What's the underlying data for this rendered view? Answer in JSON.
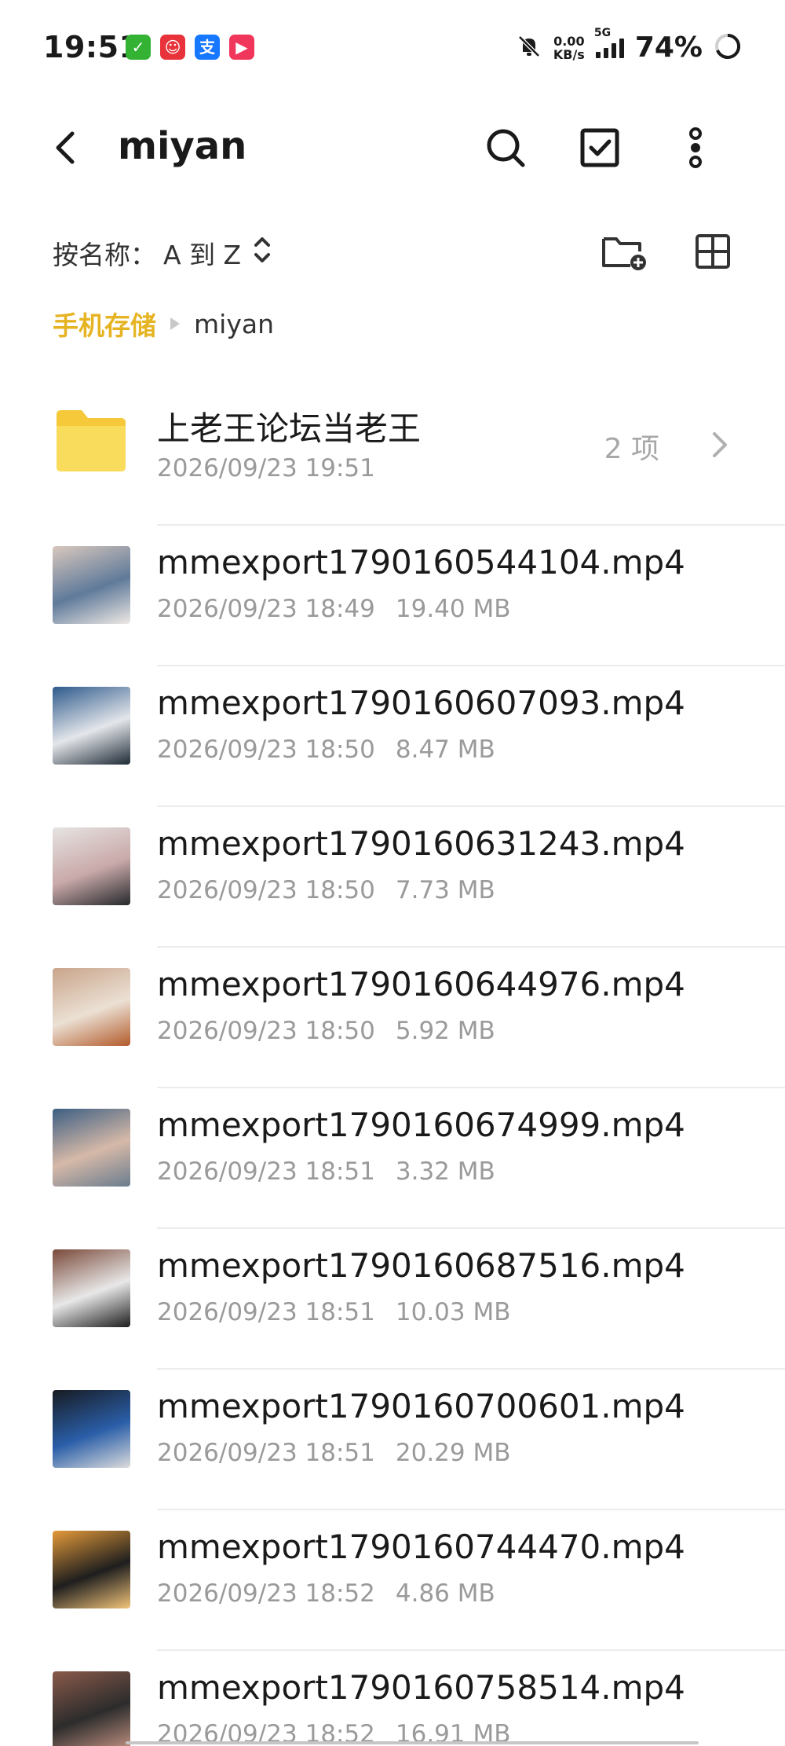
{
  "status_bar": {
    "time": "19:51",
    "app_icons": [
      {
        "name": "wechat-check-icon",
        "color": "#33b233",
        "glyph": "✓"
      },
      {
        "name": "fun-app-icon",
        "color": "#e8333a",
        "glyph": "☺"
      },
      {
        "name": "alipay-icon",
        "color": "#1677ff",
        "glyph": "支"
      },
      {
        "name": "video-app-icon",
        "color": "#f0365a",
        "glyph": "▶"
      }
    ],
    "net_speed_value": "0.00",
    "net_speed_unit": "KB/s",
    "network_type": "5G",
    "battery": "74%"
  },
  "header": {
    "title": "miyan"
  },
  "sort": {
    "label": "按名称：",
    "value": "A 到 Z"
  },
  "breadcrumb": {
    "root": "手机存储",
    "current": "miyan"
  },
  "folder": {
    "name": "上老王论坛当老王",
    "date": "2026/09/23 19:51",
    "count": "2 项"
  },
  "files": [
    {
      "name": "mmexport1790160544104.mp4",
      "date": "2026/09/23 18:49",
      "size": "19.40 MB"
    },
    {
      "name": "mmexport1790160607093.mp4",
      "date": "2026/09/23 18:50",
      "size": "8.47 MB"
    },
    {
      "name": "mmexport1790160631243.mp4",
      "date": "2026/09/23 18:50",
      "size": "7.73 MB"
    },
    {
      "name": "mmexport1790160644976.mp4",
      "date": "2026/09/23 18:50",
      "size": "5.92 MB"
    },
    {
      "name": "mmexport1790160674999.mp4",
      "date": "2026/09/23 18:51",
      "size": "3.32 MB"
    },
    {
      "name": "mmexport1790160687516.mp4",
      "date": "2026/09/23 18:51",
      "size": "10.03 MB"
    },
    {
      "name": "mmexport1790160700601.mp4",
      "date": "2026/09/23 18:51",
      "size": "20.29 MB"
    },
    {
      "name": "mmexport1790160744470.mp4",
      "date": "2026/09/23 18:52",
      "size": "4.86 MB"
    },
    {
      "name": "mmexport1790160758514.mp4",
      "date": "2026/09/23 18:52",
      "size": "16.91 MB"
    }
  ],
  "colors": {
    "accent": "#e6b422",
    "folder": "#f7d94c",
    "text_primary": "#1a1a1a",
    "text_secondary": "#9a9a9a"
  }
}
